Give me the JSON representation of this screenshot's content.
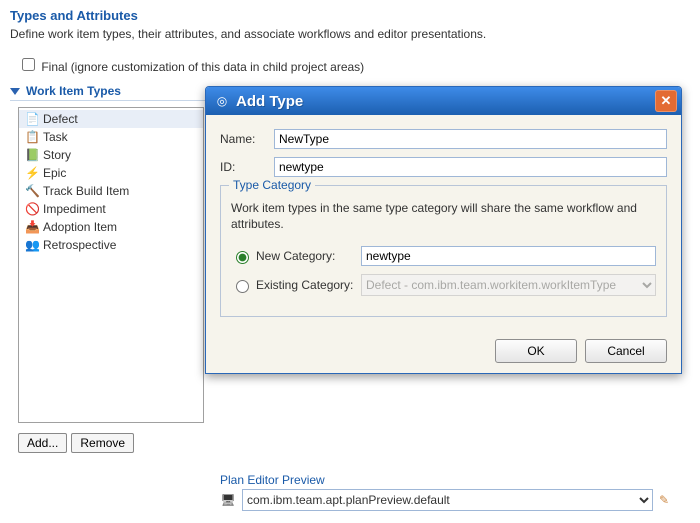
{
  "page": {
    "title": "Types and Attributes",
    "description": "Define work item types, their attributes, and associate workflows and editor presentations.",
    "final_checkbox_label": "Final (ignore customization of this data in child project areas)"
  },
  "section": {
    "title": "Work Item Types",
    "items": [
      {
        "icon": "📄",
        "label": "Defect"
      },
      {
        "icon": "📋",
        "label": "Task"
      },
      {
        "icon": "📗",
        "label": "Story"
      },
      {
        "icon": "⚡",
        "label": "Epic"
      },
      {
        "icon": "🔨",
        "label": "Track Build Item"
      },
      {
        "icon": "🚫",
        "label": "Impediment"
      },
      {
        "icon": "📥",
        "label": "Adoption Item"
      },
      {
        "icon": "👥",
        "label": "Retrospective"
      }
    ]
  },
  "buttons": {
    "add": "Add...",
    "remove": "Remove"
  },
  "plan_editor": {
    "label": "Plan Editor Preview",
    "value": "com.ibm.team.apt.planPreview.default"
  },
  "dialog": {
    "title": "Add Type",
    "name_label": "Name:",
    "name_value": "NewType",
    "id_label": "ID:",
    "id_value": "newtype",
    "category": {
      "legend": "Type Category",
      "desc": "Work item types in the same type category will share the same workflow and attributes.",
      "new_label": "New Category:",
      "new_value": "newtype",
      "existing_label": "Existing Category:",
      "existing_value": "Defect - com.ibm.team.workitem.workItemType"
    },
    "ok": "OK",
    "cancel": "Cancel"
  }
}
